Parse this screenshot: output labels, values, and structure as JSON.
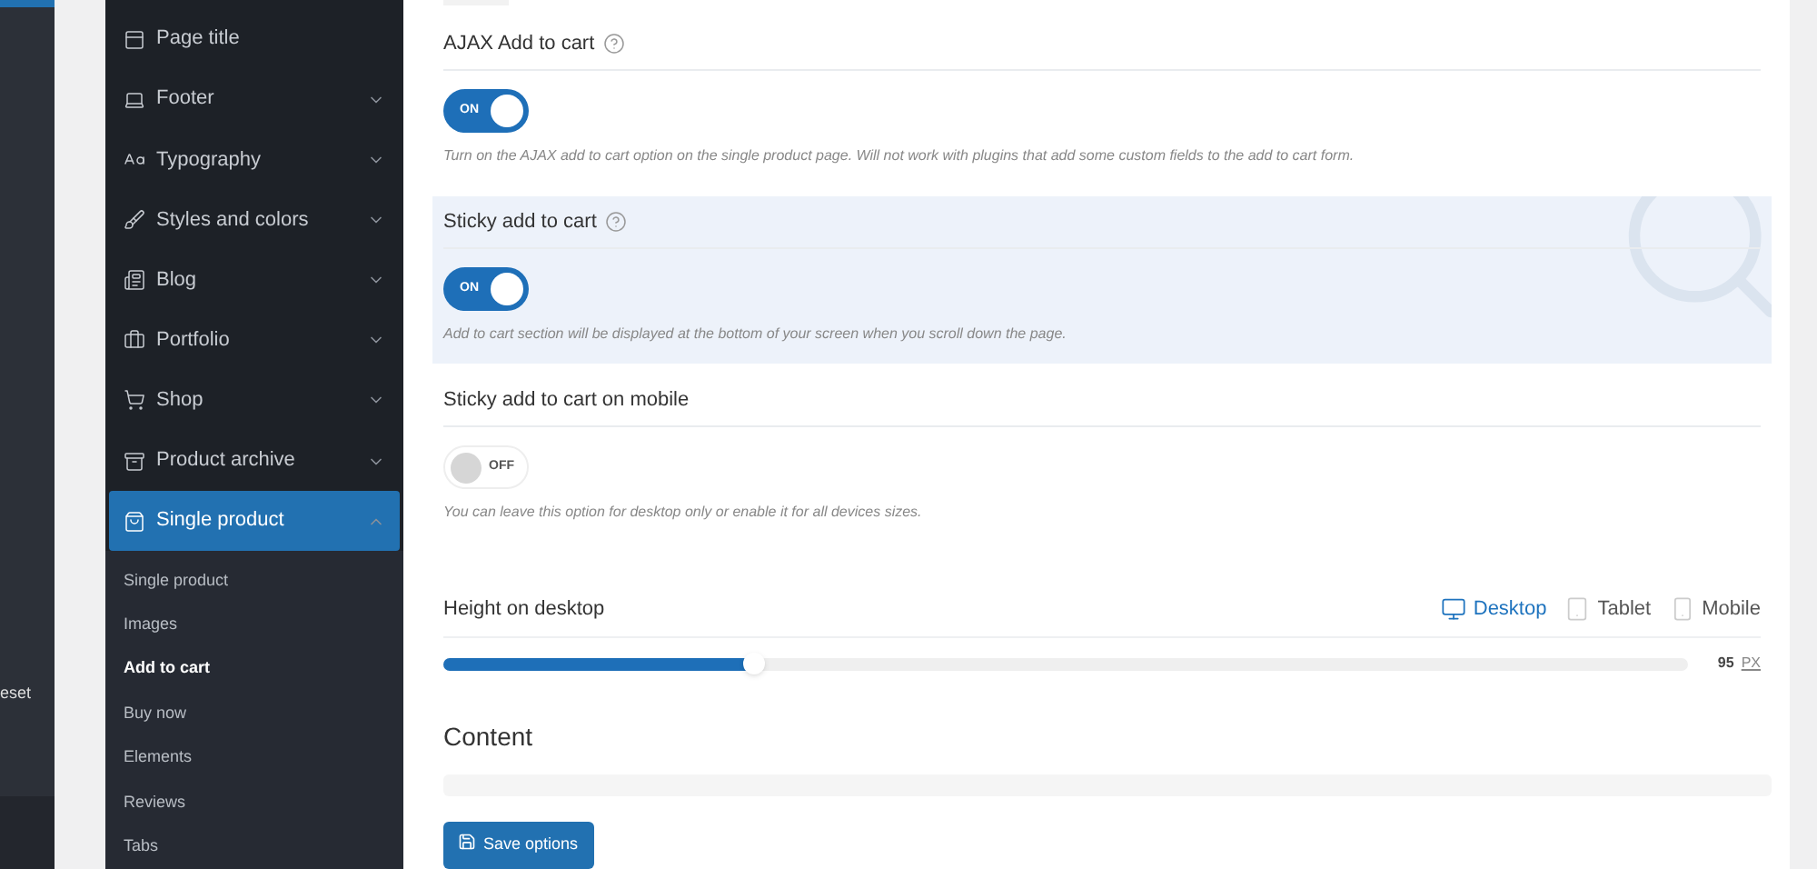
{
  "left_panel": {
    "label": "eset"
  },
  "sidebar": {
    "items": [
      {
        "label": "Page title",
        "has_submenu": false,
        "expanded": false,
        "selected": false
      },
      {
        "label": "Footer",
        "has_submenu": true,
        "expanded": false,
        "selected": false
      },
      {
        "label": "Typography",
        "has_submenu": true,
        "expanded": false,
        "selected": false
      },
      {
        "label": "Styles and colors",
        "has_submenu": true,
        "expanded": false,
        "selected": false
      },
      {
        "label": "Blog",
        "has_submenu": true,
        "expanded": false,
        "selected": false
      },
      {
        "label": "Portfolio",
        "has_submenu": true,
        "expanded": false,
        "selected": false
      },
      {
        "label": "Shop",
        "has_submenu": true,
        "expanded": false,
        "selected": false
      },
      {
        "label": "Product archive",
        "has_submenu": true,
        "expanded": false,
        "selected": false
      },
      {
        "label": "Single product",
        "has_submenu": true,
        "expanded": true,
        "selected": true,
        "children": [
          {
            "label": "Single product",
            "selected": false
          },
          {
            "label": "Images",
            "selected": false
          },
          {
            "label": "Add to cart",
            "selected": true
          },
          {
            "label": "Buy now",
            "selected": false
          },
          {
            "label": "Elements",
            "selected": false
          },
          {
            "label": "Reviews",
            "selected": false
          },
          {
            "label": "Tabs",
            "selected": false
          }
        ]
      }
    ]
  },
  "options": [
    {
      "kind": "toggle",
      "title": "AJAX Add to cart",
      "help": true,
      "highlighted": false,
      "on": true,
      "toggle_label": "ON",
      "description": "Turn on the AJAX add to cart option on the single product page. Will not work with plugins that add some custom fields to the add to cart form."
    },
    {
      "kind": "toggle",
      "title": "Sticky add to cart",
      "help": true,
      "highlighted": true,
      "on": true,
      "toggle_label": "ON",
      "description": "Add to cart section will be displayed at the bottom of your screen when you scroll down the page."
    },
    {
      "kind": "toggle",
      "title": "Sticky add to cart on mobile",
      "help": false,
      "highlighted": false,
      "on": false,
      "toggle_label": "OFF",
      "description": "You can leave this option for desktop only or enable it for all devices sizes."
    },
    {
      "kind": "slider",
      "title": "Height on desktop",
      "devices": [
        {
          "label": "Desktop",
          "selected": true
        },
        {
          "label": "Tablet",
          "selected": false
        },
        {
          "label": "Mobile",
          "selected": false
        }
      ],
      "level": 0.25,
      "value": "95",
      "unit": "PX"
    }
  ],
  "content_section": {
    "title": "Content"
  },
  "save_button": {
    "label": "Save options"
  }
}
